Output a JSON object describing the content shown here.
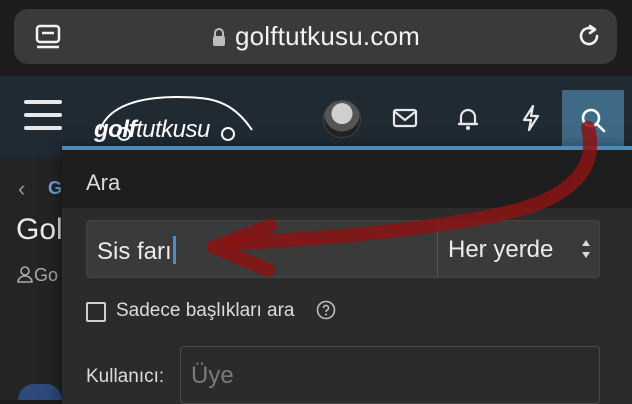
{
  "browser": {
    "url": "golftutkusu.com"
  },
  "header": {
    "logo": {
      "bold_part": "golf",
      "thin_part": "tutkusu"
    }
  },
  "background": {
    "crumb_initial": "G",
    "title_partial": "Gol",
    "author_partial": "Go"
  },
  "search": {
    "title": "Ara",
    "query": "Sis farı",
    "scope": "Her yerde",
    "titles_only_label": "Sadece başlıkları ara",
    "member_label": "Kullanıcı:",
    "member_placeholder": "Üye"
  },
  "colors": {
    "accent": "#4f89b5",
    "search_button": "#3f6a86",
    "annotation": "#8b1414"
  }
}
